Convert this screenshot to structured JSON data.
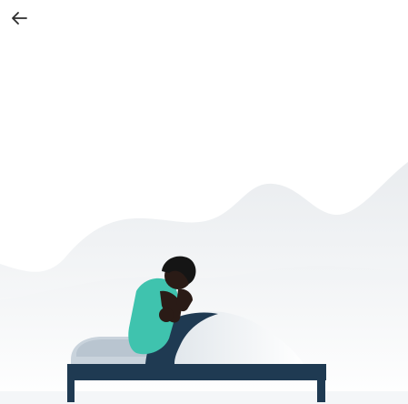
{
  "header": {
    "back_icon": "arrow-left-icon",
    "back_label": ""
  },
  "illustration": {
    "subject": "person-sitting-on-bed-icon",
    "colors": {
      "background": "#ffffff",
      "hills": "#eef0f3",
      "bed_frame": "#1f3a52",
      "mattress": "#cdd6df",
      "blanket": "#f2f4f6",
      "shirt": "#3ec7b3",
      "skin": "#2b1d18",
      "hair": "#1a1a1a",
      "arrow": "#2d2d2d"
    }
  }
}
